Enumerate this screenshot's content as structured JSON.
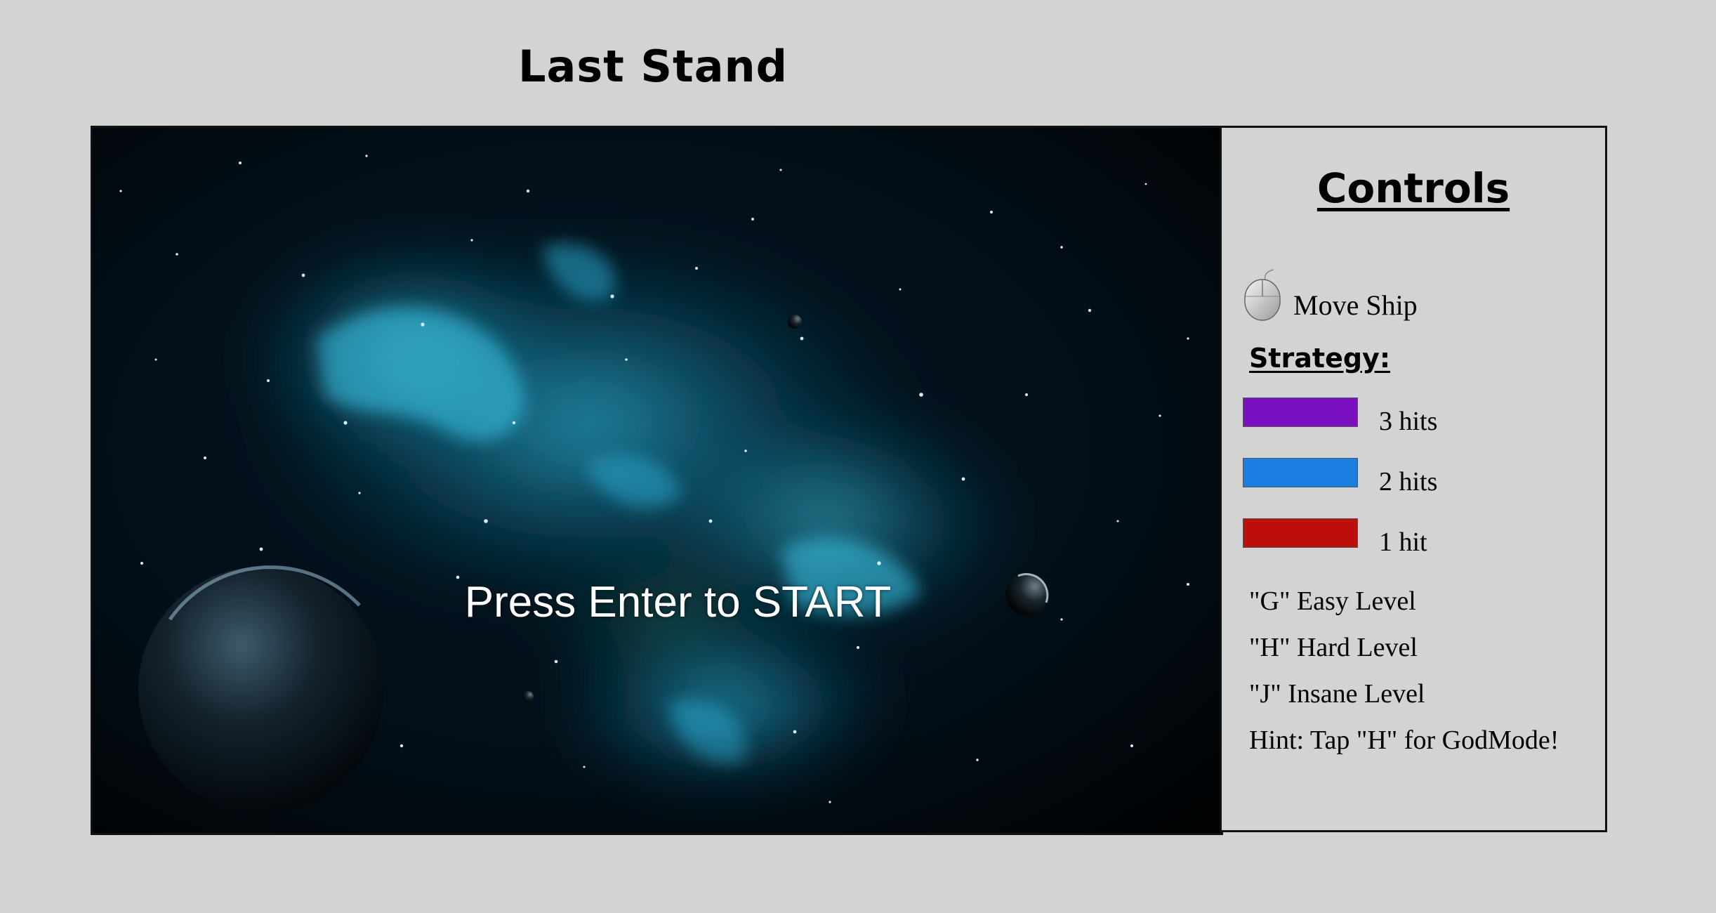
{
  "header": {
    "title": "Last Stand"
  },
  "game": {
    "start_prompt": "Press Enter to START"
  },
  "controls": {
    "heading": "Controls",
    "move_label": "Move Ship",
    "strategy_heading": "Strategy:",
    "legend": [
      {
        "label": "3 hits",
        "color": "#7a0fc0"
      },
      {
        "label": "2 hits",
        "color": "#1a7fe0"
      },
      {
        "label": "1 hit",
        "color": "#bc0f0c"
      }
    ],
    "keys": [
      "\"G\" Easy Level",
      "\"H\" Hard Level",
      "\"J\" Insane Level",
      "Hint: Tap \"H\" for GodMode!"
    ]
  },
  "icons": {
    "move": "mouse-icon"
  }
}
